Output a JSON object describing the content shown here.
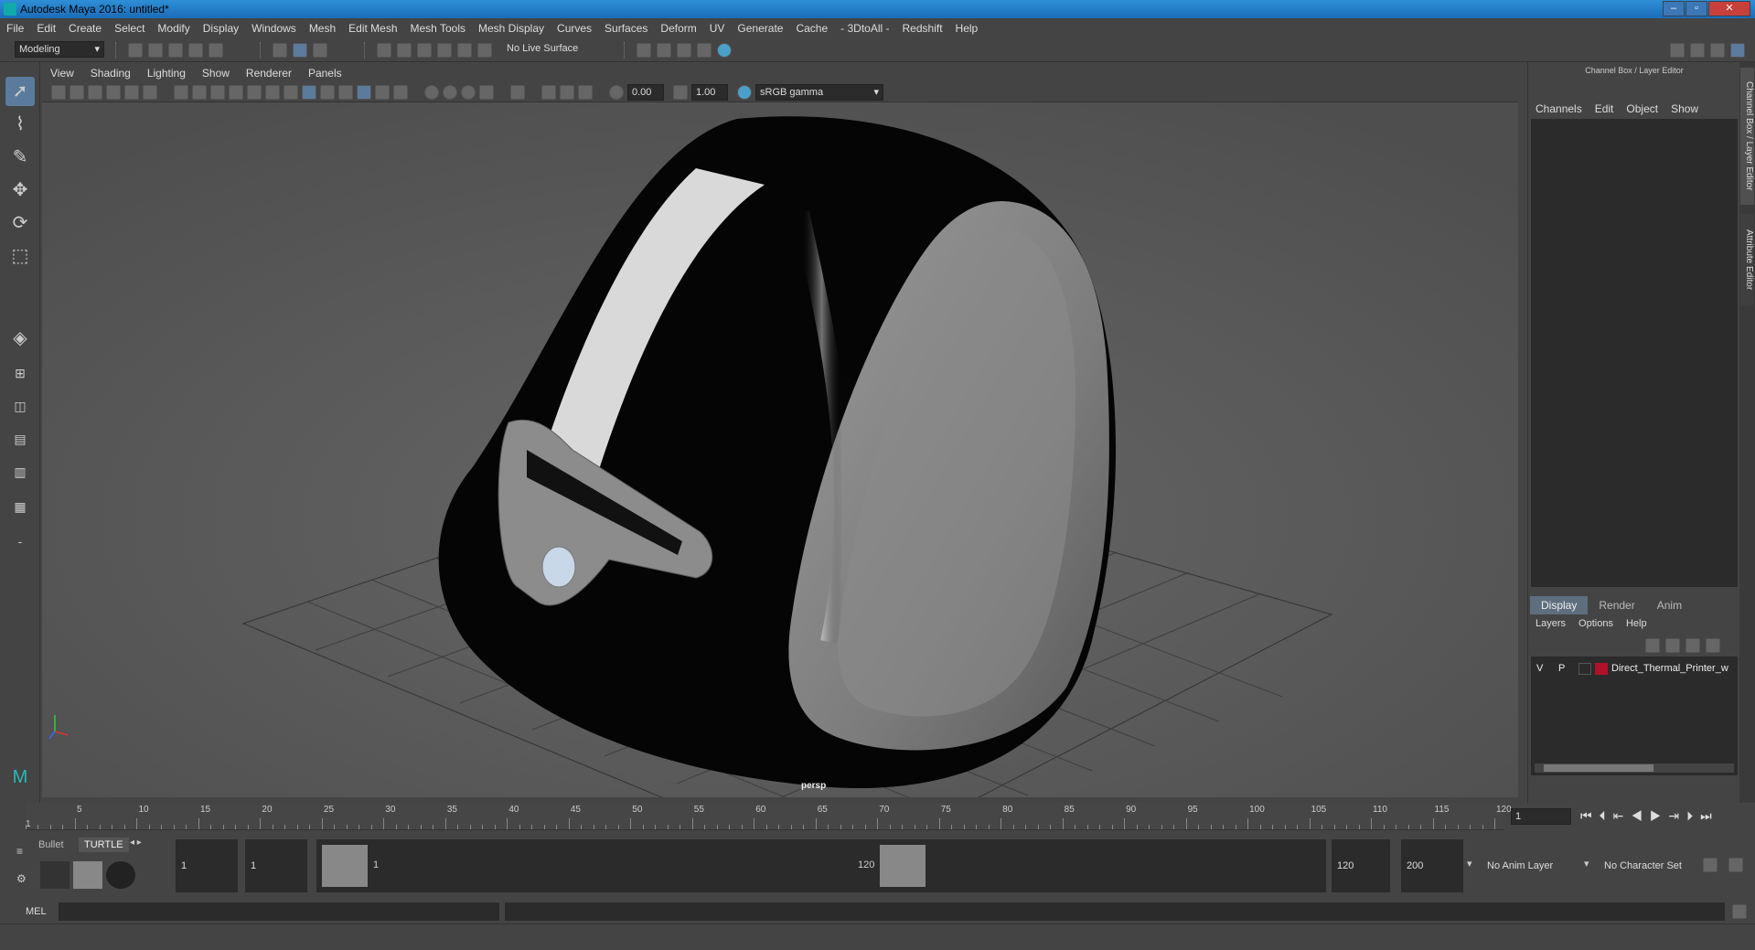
{
  "window": {
    "title": "Autodesk Maya 2016: untitled*"
  },
  "menus": [
    "File",
    "Edit",
    "Create",
    "Select",
    "Modify",
    "Display",
    "Windows",
    "Mesh",
    "Edit Mesh",
    "Mesh Tools",
    "Mesh Display",
    "Curves",
    "Surfaces",
    "Deform",
    "UV",
    "Generate",
    "Cache",
    "- 3DtoAll -",
    "Redshift",
    "Help"
  ],
  "shelf": {
    "mode": "Modeling",
    "live_surface": "No Live Surface"
  },
  "viewport": {
    "menus": [
      "View",
      "Shading",
      "Lighting",
      "Show",
      "Renderer",
      "Panels"
    ],
    "exposure": "0.00",
    "gamma": "1.00",
    "color_space": "sRGB gamma",
    "camera_label": "persp"
  },
  "channel_box": {
    "title": "Channel Box / Layer Editor",
    "menus": [
      "Channels",
      "Edit",
      "Object",
      "Show"
    ],
    "side_tabs": [
      "Channel Box / Layer Editor",
      "Attribute Editor"
    ]
  },
  "layer_editor": {
    "tabs": [
      "Display",
      "Render",
      "Anim"
    ],
    "active_tab": "Display",
    "menus": [
      "Layers",
      "Options",
      "Help"
    ],
    "layers": [
      {
        "v": "V",
        "p": "P",
        "name": "Direct_Thermal_Printer_w",
        "color": "#b0112a"
      }
    ]
  },
  "timeline": {
    "ticks": [
      "5",
      "10",
      "15",
      "20",
      "25",
      "30",
      "35",
      "40",
      "45",
      "50",
      "55",
      "60",
      "65",
      "70",
      "75",
      "80",
      "85",
      "90",
      "95",
      "100",
      "105",
      "110",
      "115",
      "120"
    ],
    "start_marker": "1",
    "current_frame": "1"
  },
  "range": {
    "shelf_tabs": [
      "Bullet",
      "TURTLE"
    ],
    "start_frame": "1",
    "playback_start": "1",
    "slider_start": "1",
    "slider_end": "120",
    "playback_end": "120",
    "end_frame": "200",
    "anim_layer": "No Anim Layer",
    "character_set": "No Character Set"
  },
  "command": {
    "language": "MEL"
  }
}
